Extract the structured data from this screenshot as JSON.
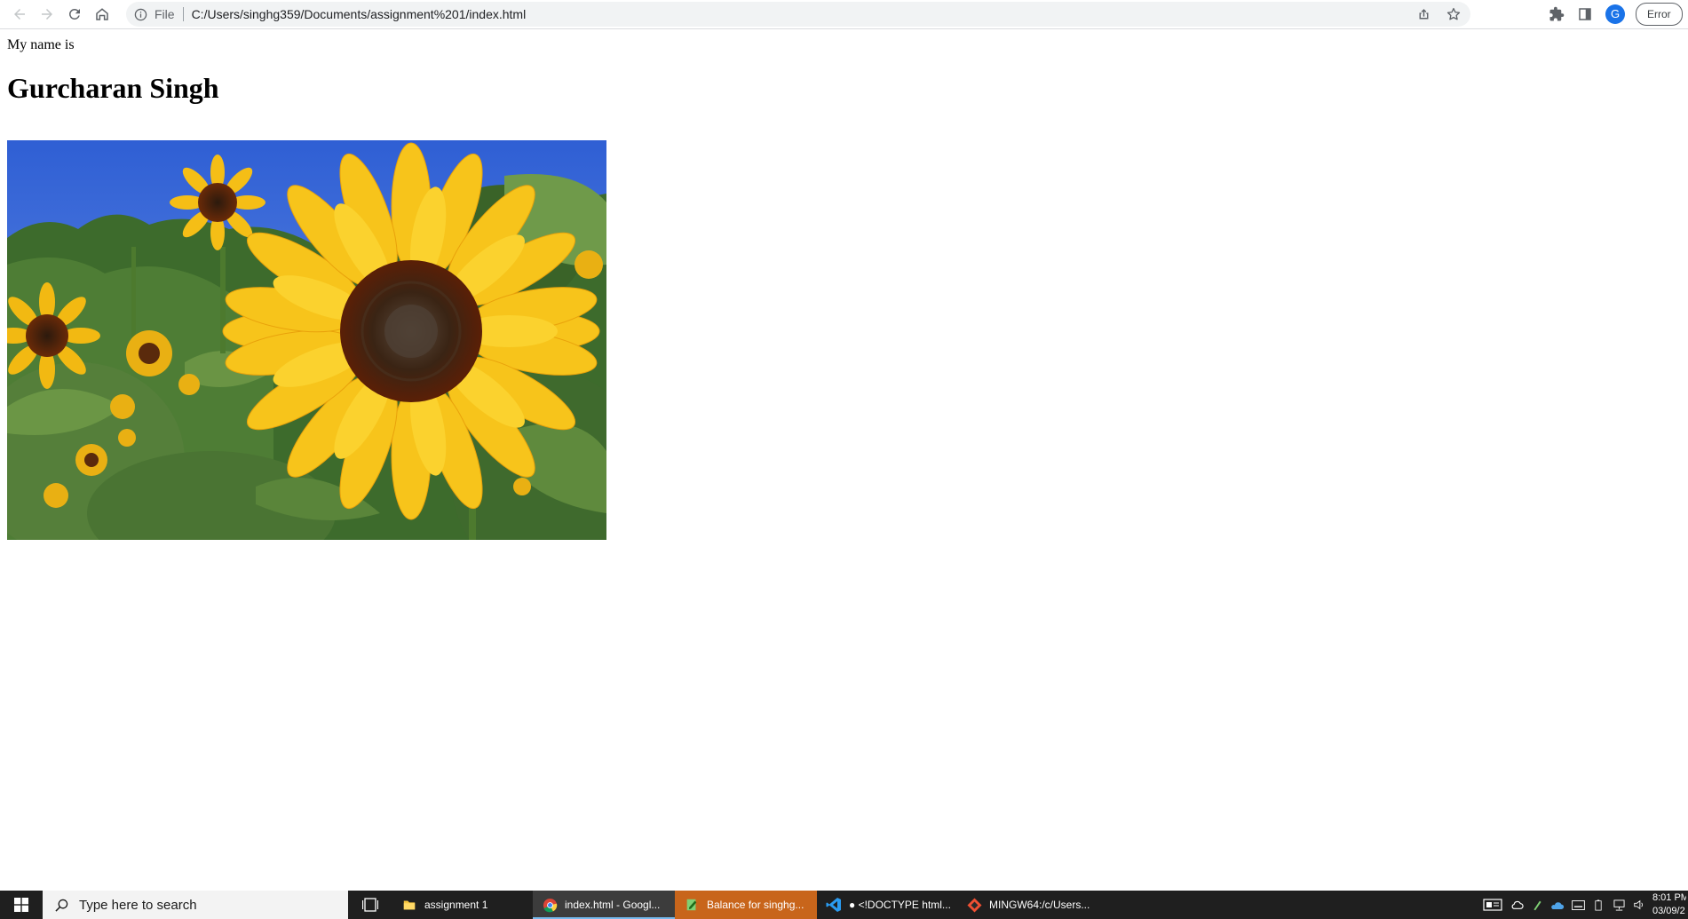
{
  "browser": {
    "scheme_label": "File",
    "url": "C:/Users/singhg359/Documents/assignment%201/index.html",
    "profile_initial": "G",
    "error_label": "Error"
  },
  "page": {
    "intro_text": "My name is",
    "name_heading": "Gurcharan Singh"
  },
  "taskbar": {
    "search_placeholder": "Type here to search",
    "tasks": [
      {
        "label": "assignment 1",
        "icon": "folder-icon"
      },
      {
        "label": "index.html - Googl...",
        "icon": "chrome-icon"
      },
      {
        "label": "Balance for singhg...",
        "icon": "notepad-icon"
      },
      {
        "label": "● <!DOCTYPE html...",
        "icon": "vscode-icon"
      },
      {
        "label": "MINGW64:/c/Users...",
        "icon": "git-icon"
      }
    ],
    "clock_time": "8:01 PM",
    "clock_date": "03/09/2"
  },
  "colors": {
    "accent": "#1a73e8",
    "taskbar_bg": "#1f1f1f",
    "flash_task": "#c8651b"
  }
}
